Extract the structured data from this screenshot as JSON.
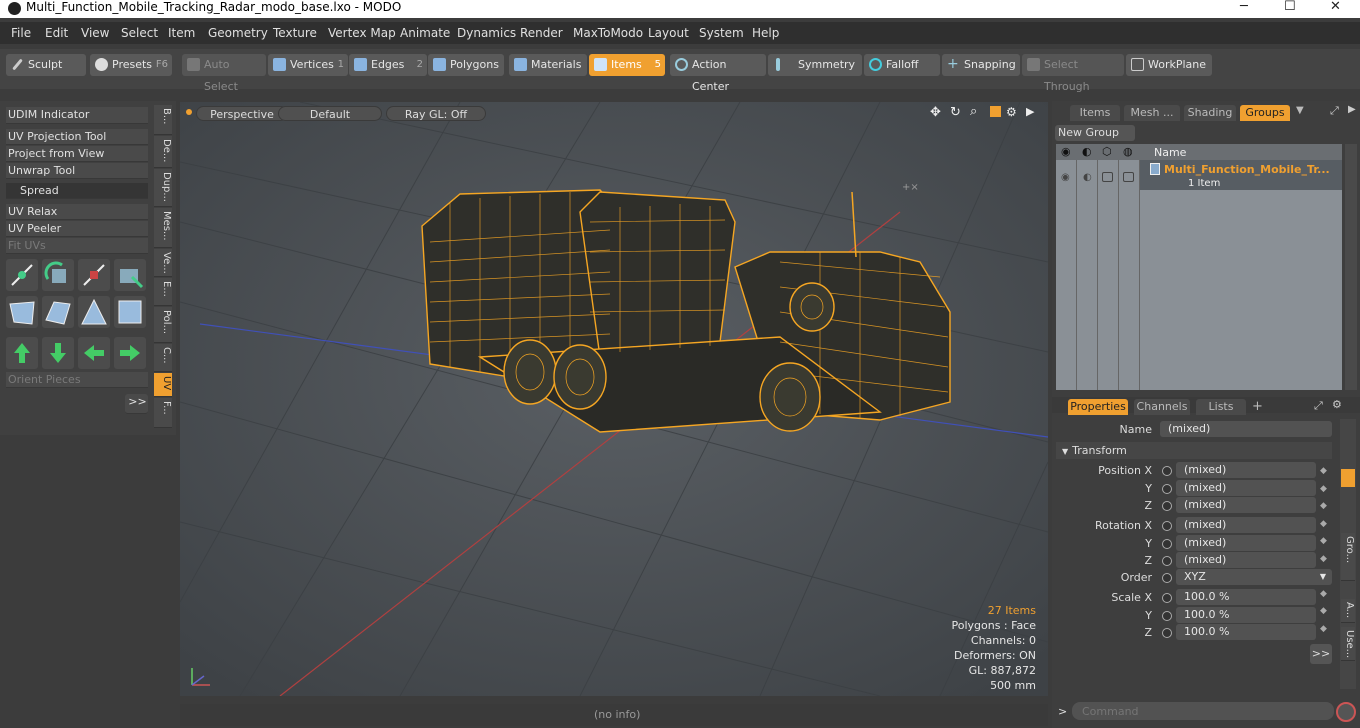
{
  "window": {
    "title": "Multi_Function_Mobile_Tracking_Radar_modo_base.lxo - MODO",
    "min": "─",
    "max": "☐",
    "close": "✕"
  },
  "menu": [
    "File",
    "Edit",
    "View",
    "Select",
    "Item",
    "Geometry",
    "Texture",
    "Vertex Map",
    "Animate",
    "Dynamics",
    "Render",
    "MaxToModo",
    "Layout",
    "System",
    "Help"
  ],
  "toolbar": {
    "sculpt": "Sculpt",
    "presets": "Presets",
    "presets_key": "F6",
    "auto_select": "Auto Select",
    "vertices": "Vertices",
    "vertices_key": "1",
    "edges": "Edges",
    "edges_key": "2",
    "polygons": "Polygons",
    "materials": "Materials",
    "items": "Items",
    "items_key": "5",
    "action_center": "Action Center",
    "symmetry": "Symmetry",
    "falloff": "Falloff",
    "snapping": "Snapping",
    "select_through": "Select Through",
    "workplane": "WorkPlane"
  },
  "left": {
    "udim": "UDIM Indicator",
    "uv_projection": "UV Projection Tool",
    "project_from_view": "Project from View",
    "unwrap": "Unwrap Tool",
    "spread": "Spread",
    "uv_relax": "UV Relax",
    "uv_peeler": "UV Peeler",
    "fit_uvs": "Fit UVs",
    "orient_pieces": "Orient Pieces",
    "more": ">>",
    "vtabs": [
      "B...",
      "De...",
      "Dup...",
      "Mes...",
      "Ve...",
      "E...",
      "Pol...",
      "C...",
      "UV",
      "F..."
    ]
  },
  "viewport": {
    "perspective": "Perspective",
    "default": "Default",
    "raygl": "Ray GL: Off",
    "stats": {
      "items": "27 Items",
      "polygons": "Polygons : Face",
      "channels": "Channels: 0",
      "deformers": "Deformers: ON",
      "gl": "GL: 887,872",
      "size": "500 mm"
    }
  },
  "groups": {
    "tabs": [
      "Items",
      "Mesh ...",
      "Shading",
      "Groups"
    ],
    "new_group": "New Group",
    "col_name": "Name",
    "item_name": "Multi_Function_Mobile_Tr...",
    "item_count": "1 Item"
  },
  "properties": {
    "tabs": [
      "Properties",
      "Channels",
      "Lists"
    ],
    "add": "+",
    "name_label": "Name",
    "name_value": "(mixed)",
    "transform": "Transform",
    "position_x": "Position X",
    "y": "Y",
    "z": "Z",
    "rotation_x": "Rotation X",
    "order": "Order",
    "order_value": "XYZ",
    "scale_x": "Scale X",
    "mixed": "(mixed)",
    "scale_val": "100.0 %",
    "more": ">>",
    "side_tabs": [
      "Gro...",
      "A...",
      "Use..."
    ]
  },
  "status": {
    "info": "(no info)",
    "command_placeholder": "Command",
    "prompt": ">"
  },
  "colors": {
    "accent": "#f0a030",
    "wire": "#f5a623"
  }
}
